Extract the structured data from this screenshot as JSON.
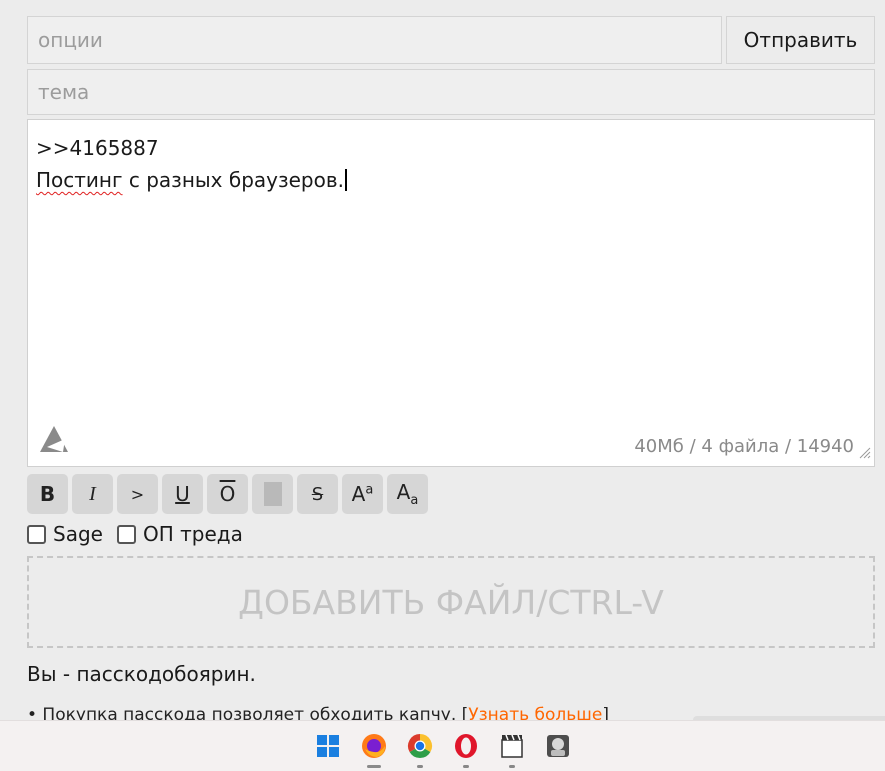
{
  "form": {
    "options_placeholder": "опции",
    "send_label": "Отправить",
    "subject_placeholder": "тема",
    "message": {
      "reply_ref": ">>4165887",
      "line2_misspelled": "Постинг",
      "line2_rest": " с разных браузеров.",
      "limits": "40Мб / 4 файла / 14940"
    },
    "toolbar": [
      {
        "name": "bold-button",
        "label": "B"
      },
      {
        "name": "italic-button",
        "label": "I"
      },
      {
        "name": "quote-button",
        "label": ">"
      },
      {
        "name": "underline-button",
        "label": "U"
      },
      {
        "name": "overline-button",
        "label": "O"
      },
      {
        "name": "spoiler-button",
        "label": ""
      },
      {
        "name": "strike-button",
        "label": "S"
      },
      {
        "name": "superscript-button",
        "label": "Aa"
      },
      {
        "name": "subscript-button",
        "label": "Aa"
      }
    ],
    "sage_label": "Sage",
    "op_label": "ОП треда",
    "dropzone_label": "ДОБАВИТЬ ФАЙЛ/CTRL-V"
  },
  "passcode_status": "Вы - пасскодобоярин.",
  "info": {
    "prefix": "• Покупка пасскода позволяет обходить капчу. [",
    "link": "Узнать больше",
    "suffix": "]"
  },
  "taskbar": {
    "apps": [
      "windows-start",
      "firefox",
      "chrome",
      "opera",
      "media-player-classic",
      "avatar-app"
    ],
    "active": "firefox"
  },
  "colors": {
    "link": "#ff6600",
    "page_bg": "#ececec",
    "spellcheck": "#e02020"
  }
}
